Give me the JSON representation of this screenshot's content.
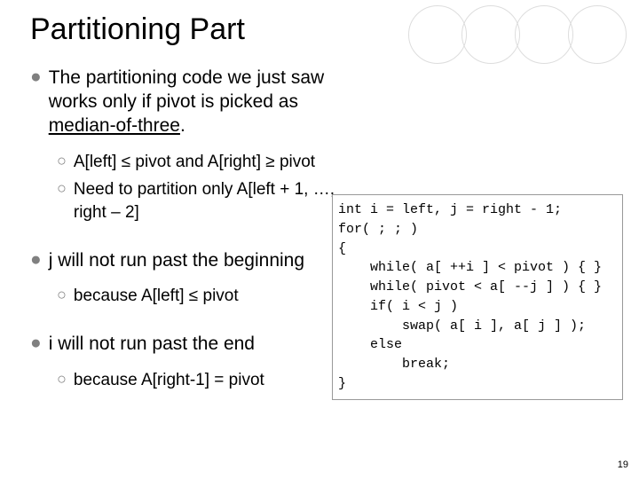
{
  "title": "Partitioning Part",
  "bullets": {
    "b1_pre": "The partitioning code we just saw works only if pivot is picked as ",
    "b1_under": "median-of-three",
    "b1_post": ".",
    "b1_sub1": "A[left] ≤ pivot and A[right] ≥ pivot",
    "b1_sub2": "Need to partition only A[left + 1, …, right – 2]",
    "b2": "j will not run past the beginning",
    "b2_sub1": "because A[left] ≤ pivot",
    "b3": "i will not run past the end",
    "b3_sub1": "because A[right-1] = pivot"
  },
  "code": "int i = left, j = right - 1;\nfor( ; ; )\n{\n    while( a[ ++i ] < pivot ) { }\n    while( pivot < a[ --j ] ) { }\n    if( i < j )\n        swap( a[ i ], a[ j ] );\n    else\n        break;\n}",
  "pagenum": "19"
}
